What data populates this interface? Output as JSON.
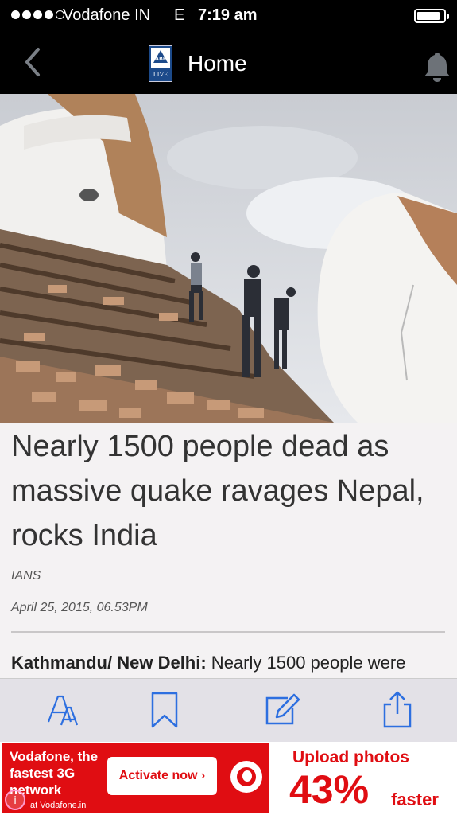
{
  "status_bar": {
    "carrier": "Vodafone IN",
    "network": "E",
    "time": "7:19 am"
  },
  "nav": {
    "title": "Home",
    "logo_top": "ABP",
    "logo_bottom": "LIVE"
  },
  "article": {
    "headline": "Nearly 1500 people dead as massive quake ravages Nepal, rocks India",
    "source": "IANS",
    "date": "April 25, 2015, 06.53PM",
    "dateline": "Kathmandu/ New Delhi:",
    "lead": " Nearly 1500 people were"
  },
  "toolbar": {
    "buttons": [
      "font-size-icon",
      "bookmark-icon",
      "edit-icon",
      "share-icon"
    ]
  },
  "ad": {
    "left_text": "Vodafone, the fastest 3G network",
    "cta": "Activate now ›",
    "headline": "Upload photos",
    "percent": "43%",
    "suffix": "faster",
    "disclaimer": "at Vodafone.in"
  },
  "colors": {
    "accent_blue": "#2d6fe0",
    "ad_red": "#e00d12"
  }
}
